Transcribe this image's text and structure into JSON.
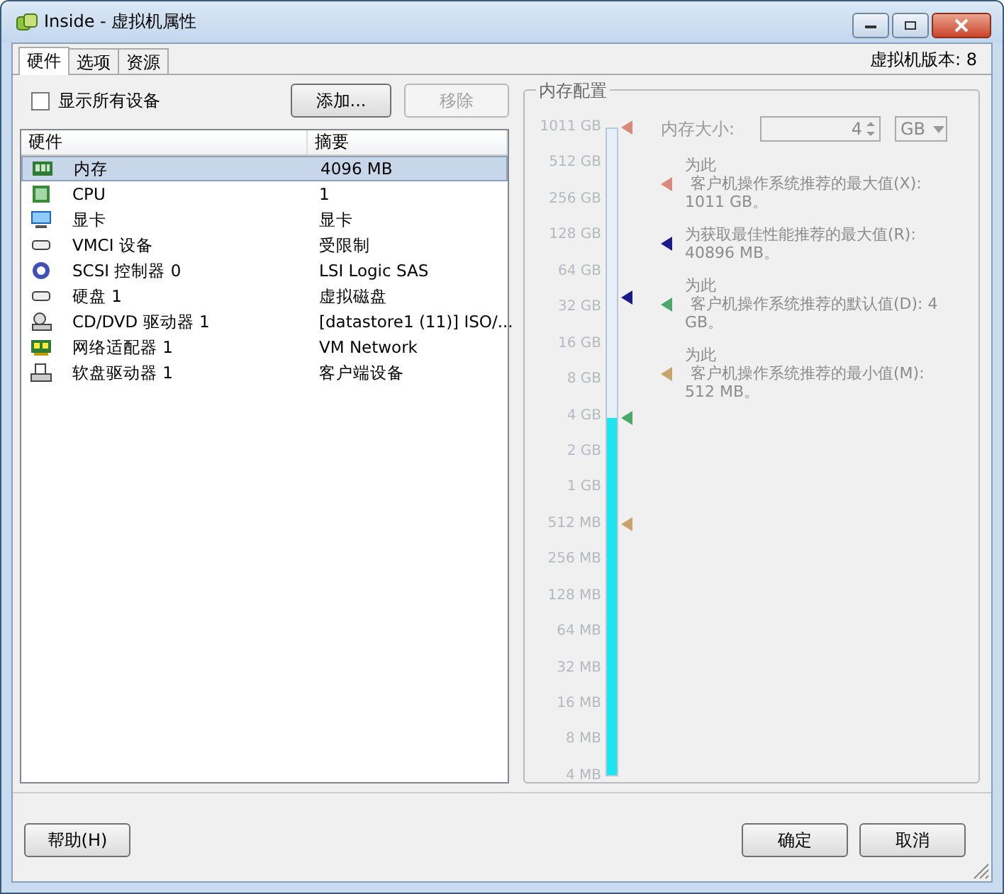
{
  "window": {
    "title": "Inside - 虚拟机属性"
  },
  "tabs": [
    {
      "label": "硬件",
      "selected": true
    },
    {
      "label": "选项",
      "selected": false
    },
    {
      "label": "资源",
      "selected": false
    }
  ],
  "version": "虚拟机版本: 8",
  "show_all": {
    "label": "显示所有设备",
    "checked": false
  },
  "buttons": [
    {
      "label": "添加...",
      "disabled": false
    },
    {
      "label": "移除",
      "disabled": true
    }
  ],
  "table": {
    "columns": [
      "硬件",
      "摘要"
    ],
    "rows": [
      {
        "name": "内存",
        "summary": "4096 MB",
        "selected": true
      },
      {
        "name": "CPU",
        "summary": "1",
        "selected": false
      },
      {
        "name": "显卡",
        "summary": "显卡",
        "selected": false
      },
      {
        "name": "VMCI 设备",
        "summary": "受限制",
        "selected": false
      },
      {
        "name": "SCSI 控制器  0",
        "summary": "LSI Logic SAS",
        "selected": false
      },
      {
        "name": "硬盘  1",
        "summary": "虚拟磁盘",
        "selected": false
      },
      {
        "name": "CD/DVD 驱动器  1",
        "summary": "[datastore1 (11)] ISO/...",
        "selected": false
      },
      {
        "name": "网络适配器  1",
        "summary": "VM Network",
        "selected": false
      },
      {
        "name": "软盘驱动器  1",
        "summary": "客户端设备",
        "selected": false
      }
    ]
  },
  "memory": {
    "title": "内存配置",
    "size_label": "内存大小:",
    "size_value": "4",
    "unit": "GB",
    "disabled": true,
    "level": 0.553,
    "scale": [
      "1011 GB",
      "512 GB",
      "256 GB",
      "128 GB",
      "64 GB",
      "32 GB",
      "16 GB",
      "8 GB",
      "4 GB",
      "2 GB",
      "1 GB",
      "512 MB",
      "256 MB",
      "128 MB",
      "64 MB",
      "32 MB",
      "16 MB",
      "8 MB",
      "4 MB"
    ],
    "markers": [
      {
        "color": "#d98a7a",
        "level": 1.0
      },
      {
        "color": "#1a1a8a",
        "level": 0.739
      },
      {
        "color": "#4aa86a",
        "level": 0.553
      },
      {
        "color": "#c8a46a",
        "level": 0.388
      }
    ],
    "legend": [
      {
        "lines": [
          "为此",
          "客户机操作系统推荐的最大值(X):",
          "1011 GB。"
        ],
        "color": "#d98a7a"
      },
      {
        "lines": [
          "为获取最佳性能推荐的最大值(R):",
          "40896 MB。"
        ],
        "color": "#1a1a8a"
      },
      {
        "lines": [
          "为此",
          "客户机操作系统推荐的默认值(D): 4",
          "GB。"
        ],
        "color": "#4aa86a"
      },
      {
        "lines": [
          "为此",
          "客户机操作系统推荐的最小值(M):",
          "512 MB。"
        ],
        "color": "#c8a46a"
      }
    ]
  },
  "footer": {
    "help": "帮助(H)",
    "ok": "确定",
    "cancel": "取消"
  }
}
